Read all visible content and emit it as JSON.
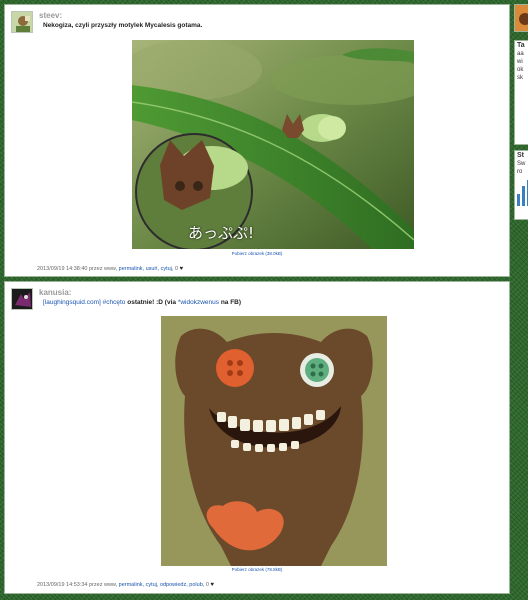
{
  "posts": [
    {
      "username": "steev:",
      "text": "Nekogiza, czyli przyszły motylek Mycalesis gotama.",
      "image_overlay_text": "あっぷぷ!",
      "caption": "Pobierz obrazek (38.0kB)",
      "timestamp": "2013/09/19 14:38:40 przez",
      "via": "www,",
      "actions": [
        "permalink,",
        "usuń,",
        "cytuj,"
      ],
      "likes": "0"
    },
    {
      "username": "kanusia:",
      "source": "[laughingsquid.com]",
      "tag1": "#chcęto",
      "text_mid": "ostatnie! :D (via",
      "tag2": "*widokzwenus",
      "text_end": "na FB)",
      "caption": "Pobierz obrazek (78.8kB)",
      "timestamp": "2013/09/19 14:53:34 przez",
      "via": "www,",
      "actions": [
        "permalink,",
        "cytuj,",
        "odpowiedz,",
        "polub,"
      ],
      "likes": "0"
    }
  ],
  "sidebar": {
    "widget1_title": "Ta",
    "widget1_lines": [
      "aa",
      "wi",
      "ok",
      "sk"
    ],
    "widget2_title": "St",
    "widget2_lines": [
      "Sw",
      "ro"
    ]
  },
  "colors": {
    "link": "#1a55b0",
    "background": "#2f6a2e",
    "leaf": "#3f8a2f"
  }
}
